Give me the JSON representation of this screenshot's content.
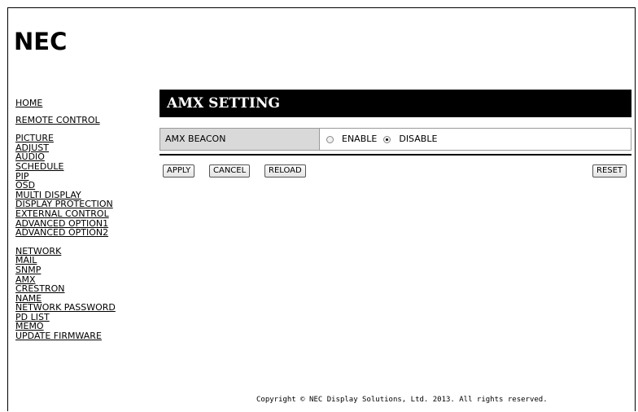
{
  "brand": {
    "logo_text": "NEC"
  },
  "nav": {
    "group1": [
      "HOME",
      "REMOTE CONTROL"
    ],
    "group2": [
      "PICTURE",
      "ADJUST",
      "AUDIO",
      "SCHEDULE",
      "PIP",
      "OSD",
      "MULTI DISPLAY",
      "DISPLAY PROTECTION",
      "EXTERNAL CONTROL",
      "ADVANCED OPTION1",
      "ADVANCED OPTION2"
    ],
    "group3": [
      "NETWORK",
      "MAIL",
      "SNMP",
      "AMX",
      "CRESTRON",
      "NAME",
      "NETWORK PASSWORD",
      "PD LIST",
      "MEMO",
      "UPDATE FIRMWARE"
    ]
  },
  "main": {
    "title": "AMX SETTING",
    "setting": {
      "label": "AMX BEACON",
      "options": [
        {
          "label": "ENABLE",
          "selected": false
        },
        {
          "label": "DISABLE",
          "selected": true
        }
      ]
    },
    "buttons": {
      "apply": "APPLY",
      "cancel": "CANCEL",
      "reload": "RELOAD",
      "reset": "RESET"
    }
  },
  "footer": {
    "copyright": "Copyright © NEC Display Solutions, Ltd. 2013. All rights reserved."
  },
  "colors": {
    "title_bg": "#000000",
    "label_bg": "#d9d9d9",
    "page_bg": "#ffffff"
  }
}
